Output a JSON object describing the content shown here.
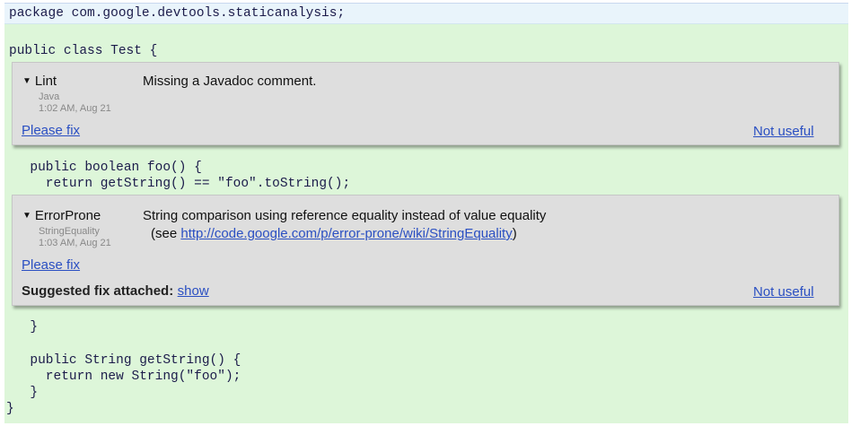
{
  "code": {
    "line1": "package com.google.devtools.staticanalysis;",
    "line2": "public class Test {",
    "line3": "  public boolean foo() {",
    "line4": "    return getString() == \"foo\".toString();",
    "line5": "  }",
    "line6": "  public String getString() {",
    "line7": "    return new String(\"foo\");",
    "line8": "  }",
    "line9": "}"
  },
  "lint_card": {
    "tool": "Lint",
    "category": "Java",
    "timestamp": "1:02 AM, Aug 21",
    "message": "Missing a Javadoc comment.",
    "please_fix": "Please fix",
    "not_useful": "Not useful"
  },
  "error_card": {
    "tool": "ErrorProne",
    "category": "StringEquality",
    "timestamp": "1:03 AM, Aug 21",
    "message": "String comparison using reference equality instead of value equality",
    "see_prefix": "(see ",
    "see_link": "http://code.google.com/p/error-prone/wiki/StringEquality",
    "see_suffix": ")",
    "please_fix": "Please fix",
    "suggested_label": "Suggested fix attached:",
    "show_link": "show",
    "not_useful": "Not useful"
  },
  "icons": {
    "expand": "triangle-down-icon"
  }
}
